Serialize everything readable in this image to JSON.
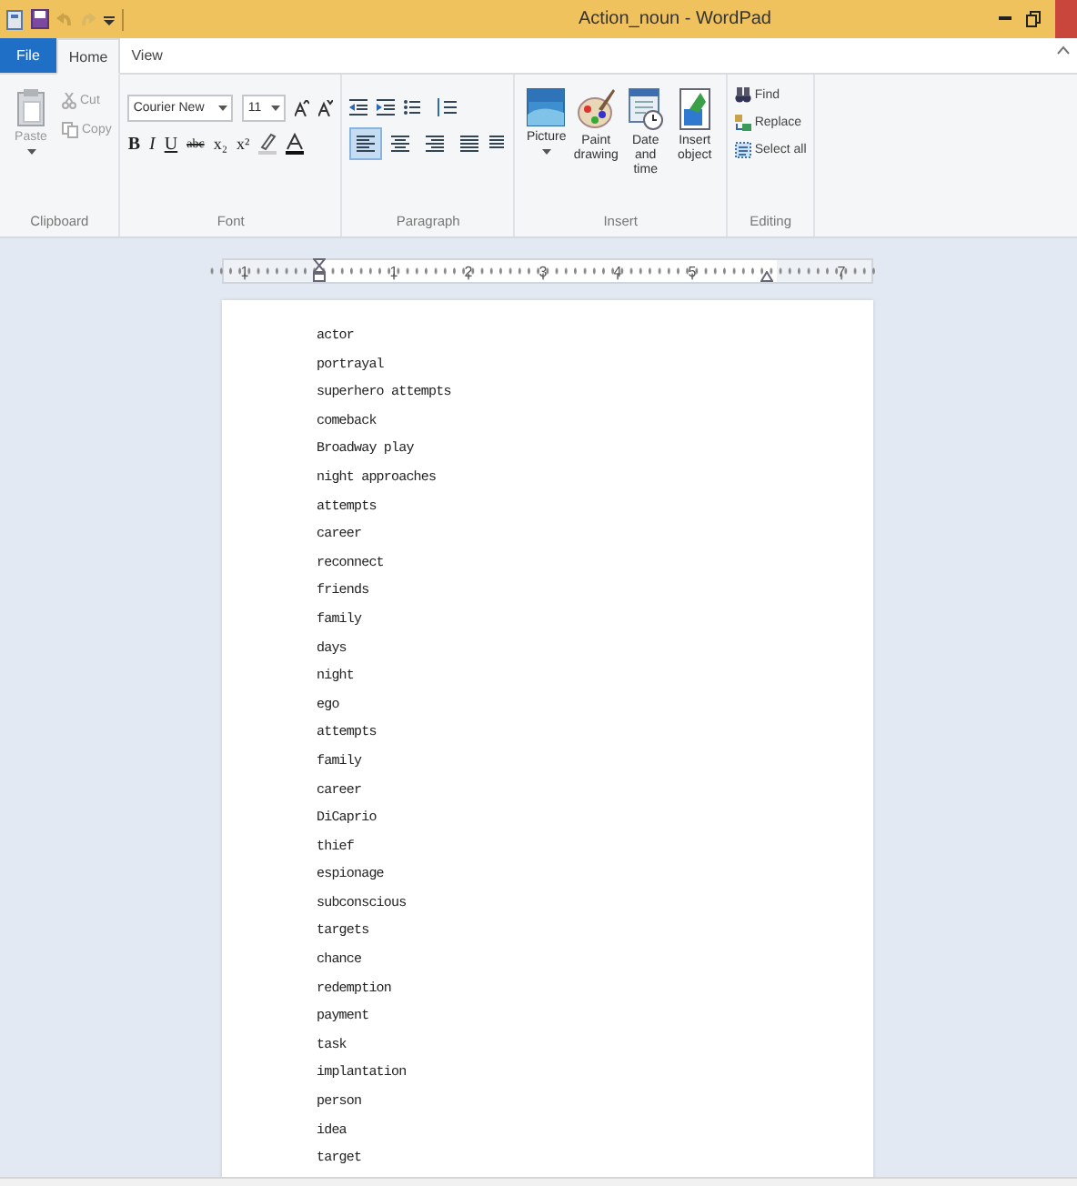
{
  "window": {
    "title": "Action_noun - WordPad"
  },
  "tabs": [
    {
      "label": "File",
      "kind": "file",
      "selected": false
    },
    {
      "label": "Home",
      "kind": "tab",
      "selected": true
    },
    {
      "label": "View",
      "kind": "tab",
      "selected": false
    }
  ],
  "ribbon": {
    "clipboard": {
      "label": "Clipboard",
      "paste": "Paste",
      "cut": "Cut",
      "copy": "Copy"
    },
    "font": {
      "label": "Font",
      "family": "Courier New",
      "size": "11",
      "styles": [
        "B",
        "I",
        "U",
        "abc",
        "x₂",
        "x²"
      ]
    },
    "paragraph": {
      "label": "Paragraph",
      "alignments": [
        {
          "kind": "left",
          "selected": true
        },
        {
          "kind": "center",
          "selected": false
        },
        {
          "kind": "right",
          "selected": false
        },
        {
          "kind": "justify",
          "selected": false
        }
      ]
    },
    "insert": {
      "label": "Insert",
      "items": [
        {
          "kind": "picture",
          "label": "Picture"
        },
        {
          "kind": "paint",
          "label": "Paint drawing"
        },
        {
          "kind": "date",
          "label": "Date and time"
        },
        {
          "kind": "object",
          "label": "Insert object"
        }
      ]
    },
    "editing": {
      "label": "Editing",
      "items": [
        {
          "kind": "find",
          "label": "Find"
        },
        {
          "kind": "replace",
          "label": "Replace"
        },
        {
          "kind": "select",
          "label": "Select all"
        }
      ]
    }
  },
  "ruler": {
    "marks": [
      {
        "kind": "number",
        "label": "1"
      },
      {
        "kind": "indent"
      },
      {
        "kind": "number",
        "label": "1"
      },
      {
        "kind": "number",
        "label": "2"
      },
      {
        "kind": "number",
        "label": "3"
      },
      {
        "kind": "number",
        "label": "4"
      },
      {
        "kind": "number",
        "label": "5"
      },
      {
        "kind": "margin"
      },
      {
        "kind": "number",
        "label": "7"
      }
    ]
  },
  "document": {
    "lines": [
      "actor",
      "portrayal",
      "superhero attempts",
      "comeback",
      "Broadway play",
      "night approaches",
      "attempts",
      "career",
      "reconnect",
      "friends",
      "family",
      "days",
      "night",
      "ego",
      "attempts",
      "family",
      "career",
      "DiCaprio",
      "thief",
      "espionage",
      "subconscious",
      "targets",
      "chance",
      "redemption",
      "payment",
      "task",
      "implantation",
      "person",
      "idea",
      "target"
    ]
  }
}
